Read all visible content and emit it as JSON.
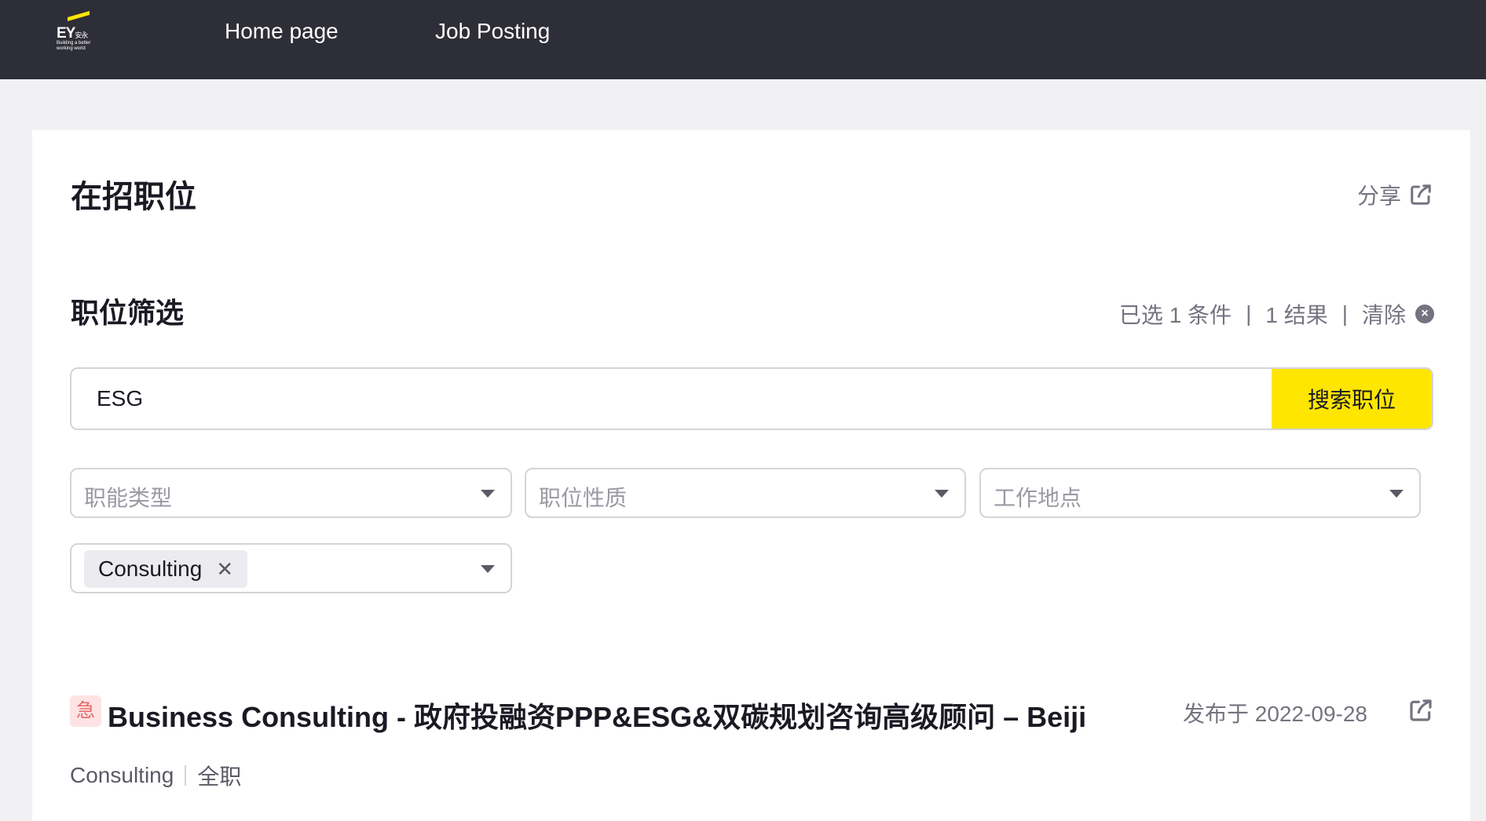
{
  "header": {
    "logo_text": "EY",
    "logo_cn": "安永",
    "logo_tagline": "Building a better working world",
    "nav": [
      {
        "label": "Home page"
      },
      {
        "label": "Job Posting"
      }
    ],
    "accent_color": "#ffe600",
    "bar_color": "#2e2e38"
  },
  "page": {
    "title": "在招职位",
    "share_label": "分享"
  },
  "filter": {
    "title": "职位筛选",
    "selected_count": "已选 1 条件",
    "result_count": "1 结果",
    "clear_label": "清除",
    "search_value": "ESG",
    "search_button": "搜索职位",
    "selects": [
      {
        "placeholder": "职能类型"
      },
      {
        "placeholder": "职位性质"
      },
      {
        "placeholder": "工作地点"
      }
    ],
    "active_chip": "Consulting"
  },
  "jobs": [
    {
      "urgent_badge": "急",
      "title": "Business Consulting - 政府投融资PPP&ESG&双碳规划咨询高级顾问 – Beijing",
      "date": "发布于 2022-09-28",
      "category": "Consulting",
      "type": "全职"
    }
  ]
}
